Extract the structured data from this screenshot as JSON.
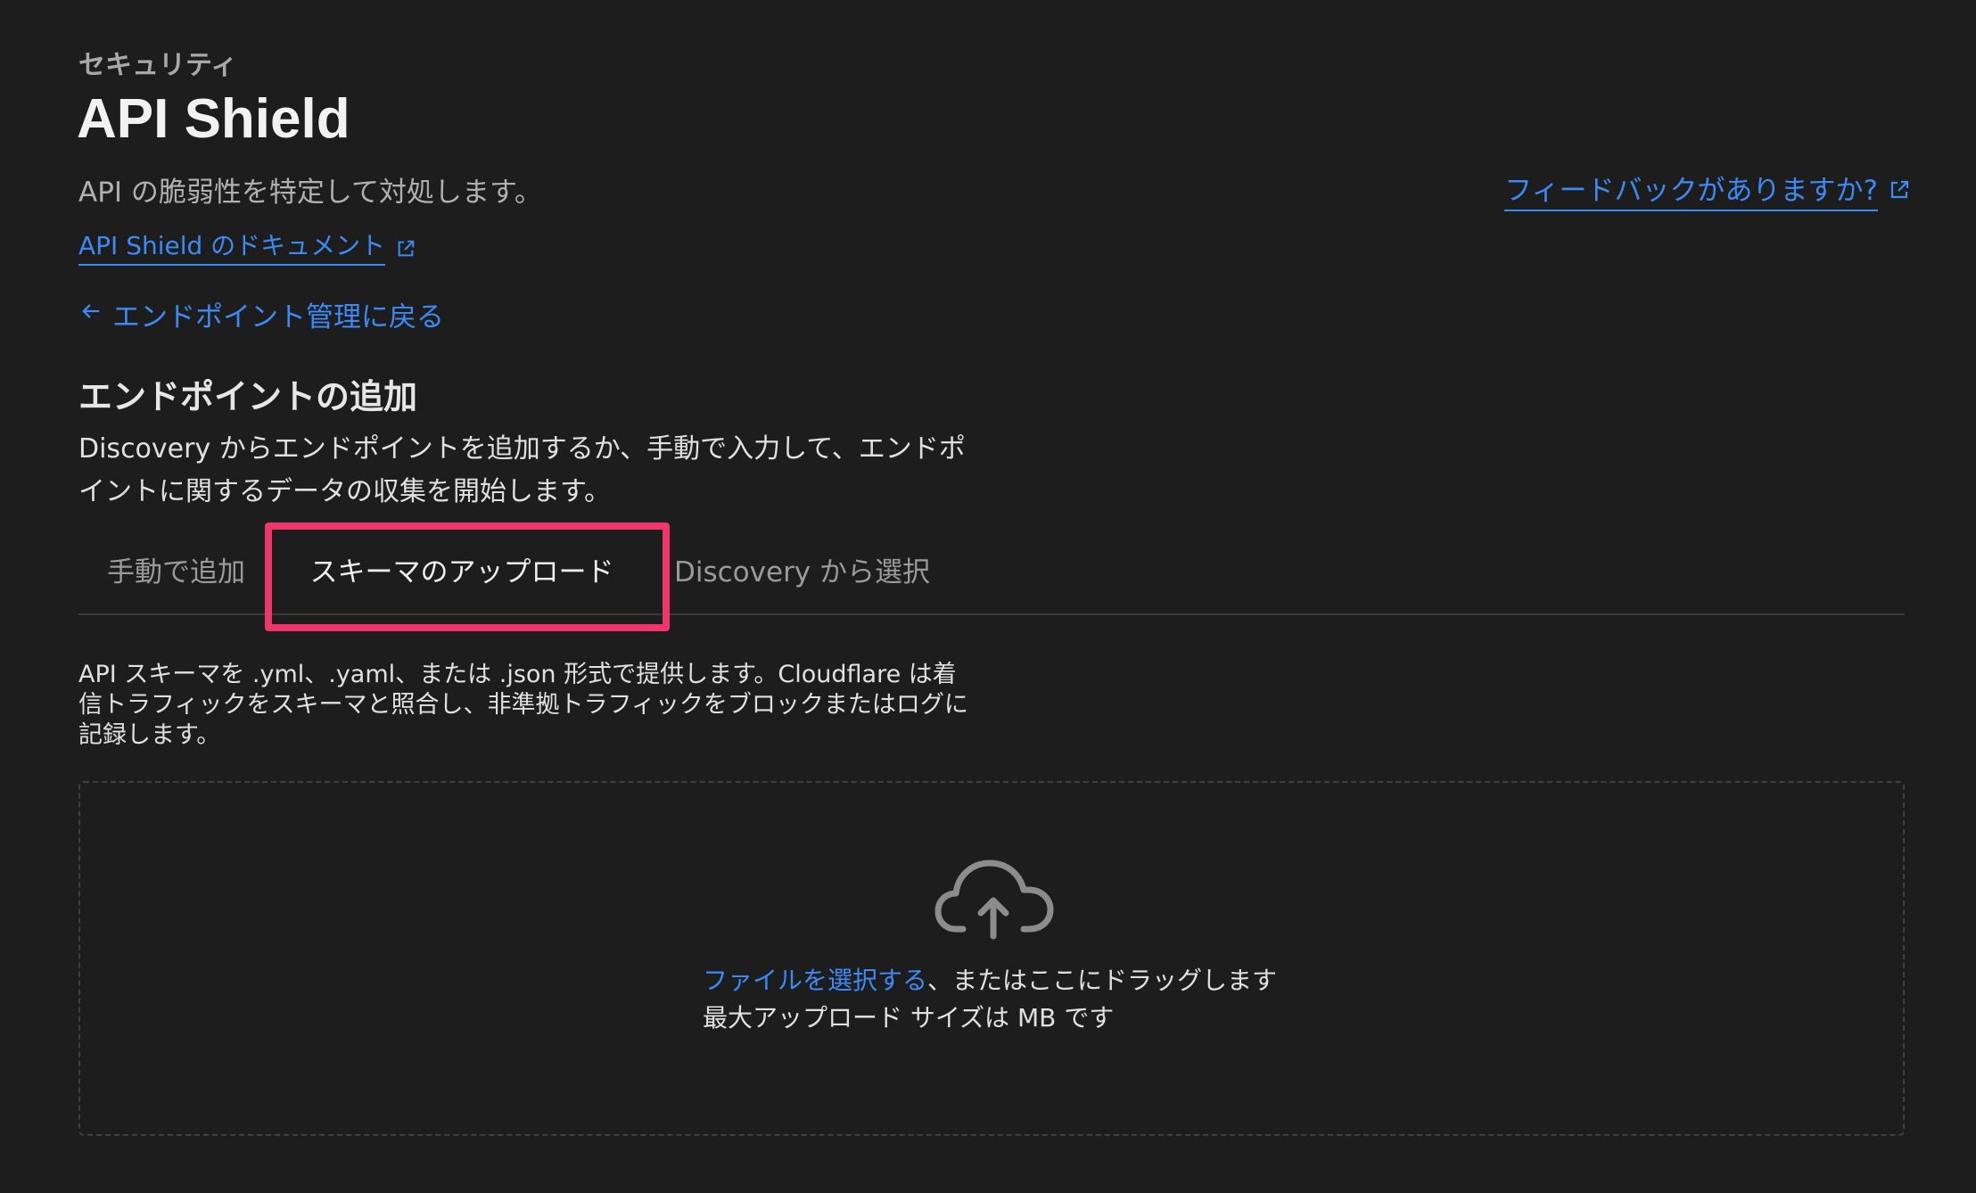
{
  "header": {
    "eyebrow": "セキュリティ",
    "title": "API Shield",
    "subtitle": "API の脆弱性を特定して対処します。",
    "docs_link": "API Shield のドキュメント",
    "feedback_link": "フィードバックがありますか?"
  },
  "nav": {
    "back_link": "エンドポイント管理に戻る"
  },
  "section": {
    "title": "エンドポイントの追加",
    "description": "Discovery からエンドポイントを追加するか、手動で入力して、エンドポイントに関するデータの収集を開始します。"
  },
  "tabs": [
    {
      "label": "手動で追加",
      "active": false
    },
    {
      "label": "スキーマのアップロード",
      "active": true
    },
    {
      "label": "Discovery から選択",
      "active": false
    }
  ],
  "upload": {
    "description": "API スキーマを .yml、.yaml、または .json 形式で提供します。Cloudflare は着信トラフィックをスキーマと照合し、非準拠トラフィックをブロックまたはログに記録します。",
    "select_file_link": "ファイルを選択する",
    "drag_text": "、またはここにドラッグします",
    "max_size_text": "最大アップロード サイズは MB です",
    "icon": "cloud-upload-icon"
  },
  "colors": {
    "background": "#1d1d1d",
    "link": "#3b8af5",
    "highlight": "#f0356b"
  }
}
